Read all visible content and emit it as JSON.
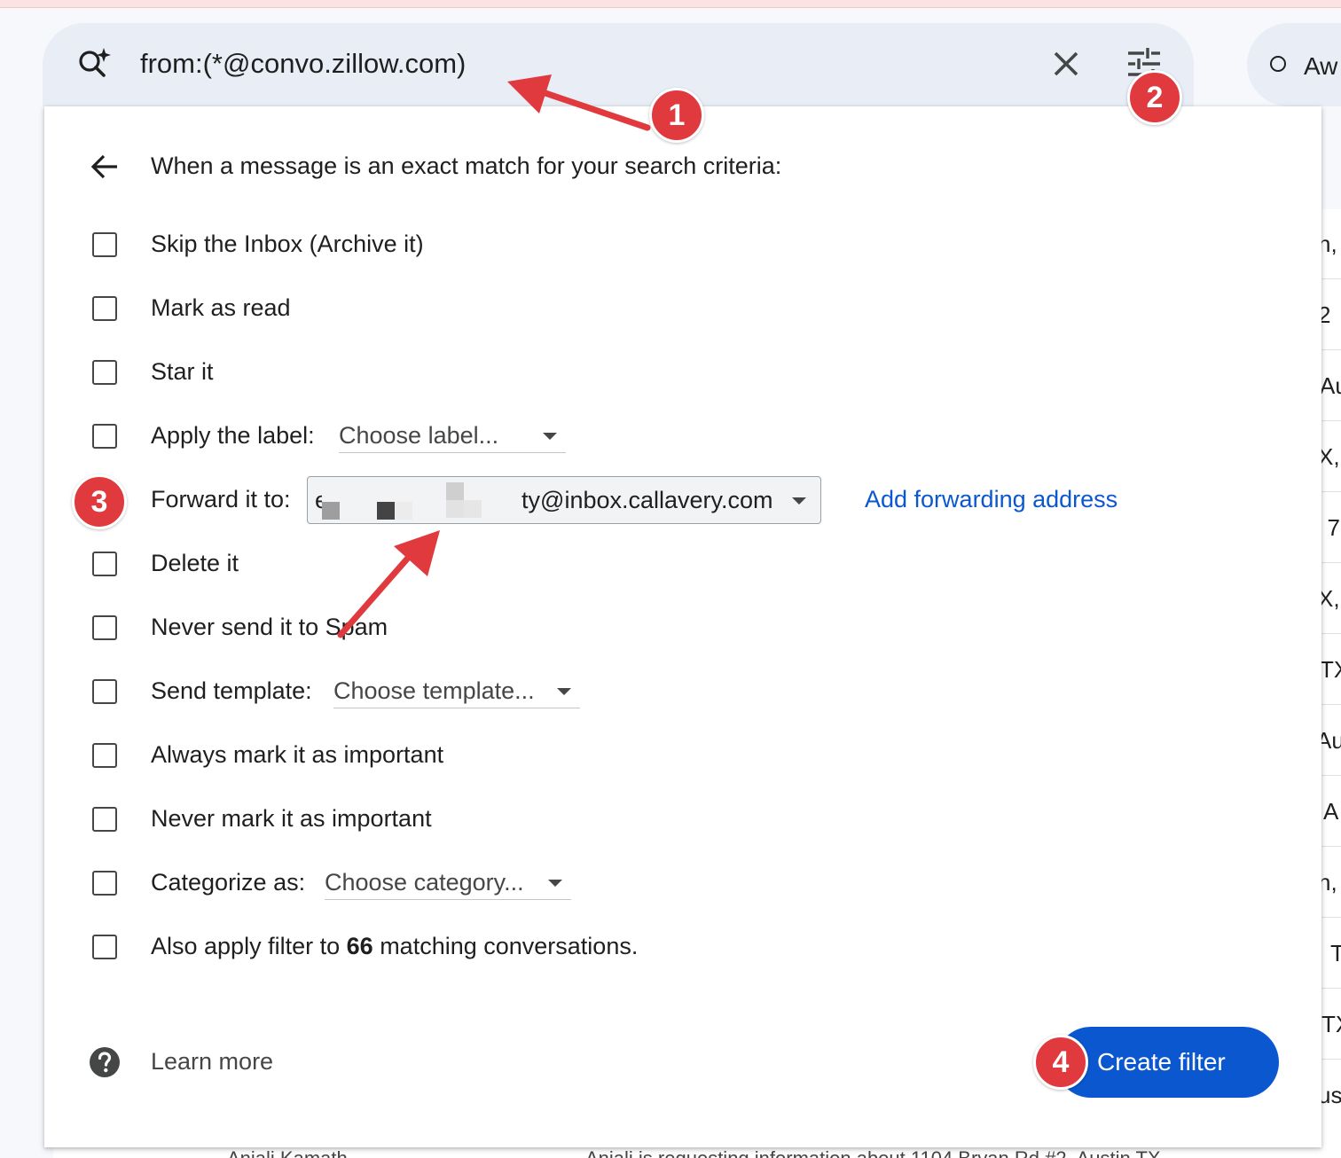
{
  "search": {
    "query": "from:(*@convo.zillow.com)",
    "icons": {
      "search": "search-sparkle-icon",
      "clear": "close-icon",
      "options": "tune-icon"
    }
  },
  "status_chip": {
    "label": "Aw"
  },
  "filter_panel": {
    "heading": "When a message is an exact match for your search criteria:",
    "options": [
      {
        "label": "Skip the Inbox (Archive it)",
        "checked": false
      },
      {
        "label": "Mark as read",
        "checked": false
      },
      {
        "label": "Star it",
        "checked": false
      },
      {
        "label": "Apply the label:",
        "checked": false,
        "dropdown": "Choose label..."
      },
      {
        "label": "Forward it to:",
        "checked": true,
        "dropdown": "ty@inbox.callavery.com"
      },
      {
        "label": "Delete it",
        "checked": false
      },
      {
        "label": "Never send it to Spam",
        "checked": false
      },
      {
        "label": "Send template:",
        "checked": false,
        "dropdown": "Choose template..."
      },
      {
        "label": "Always mark it as important",
        "checked": false
      },
      {
        "label": "Never mark it as important",
        "checked": false
      },
      {
        "label": "Categorize as:",
        "checked": false,
        "dropdown": "Choose category..."
      },
      {
        "label_prefix": "Also apply filter to",
        "count": "66",
        "label_suffix": "matching conversations.",
        "checked": false
      }
    ],
    "forward_prefix": "e",
    "add_forwarding_label": "Add forwarding address",
    "learn_more_label": "Learn more",
    "create_filter_label": "Create filter"
  },
  "annotations": [
    "1",
    "2",
    "3",
    "4"
  ],
  "background_list": {
    "row_fragments": [
      "n,",
      "2",
      "Au",
      "X,",
      ". 7",
      "X,",
      "TX",
      "Au",
      "A",
      "n,",
      "T",
      "TX",
      "us"
    ],
    "bottom_fragments": [
      "Anjali Kamath",
      "Anjali is requesting information about 1104 Bryan Rd #2, Austin TX"
    ]
  },
  "colors": {
    "accent": "#0b57d0",
    "annotation": "#e0393e",
    "panel_bg": "#ffffff",
    "search_bg": "#e9eef6"
  }
}
